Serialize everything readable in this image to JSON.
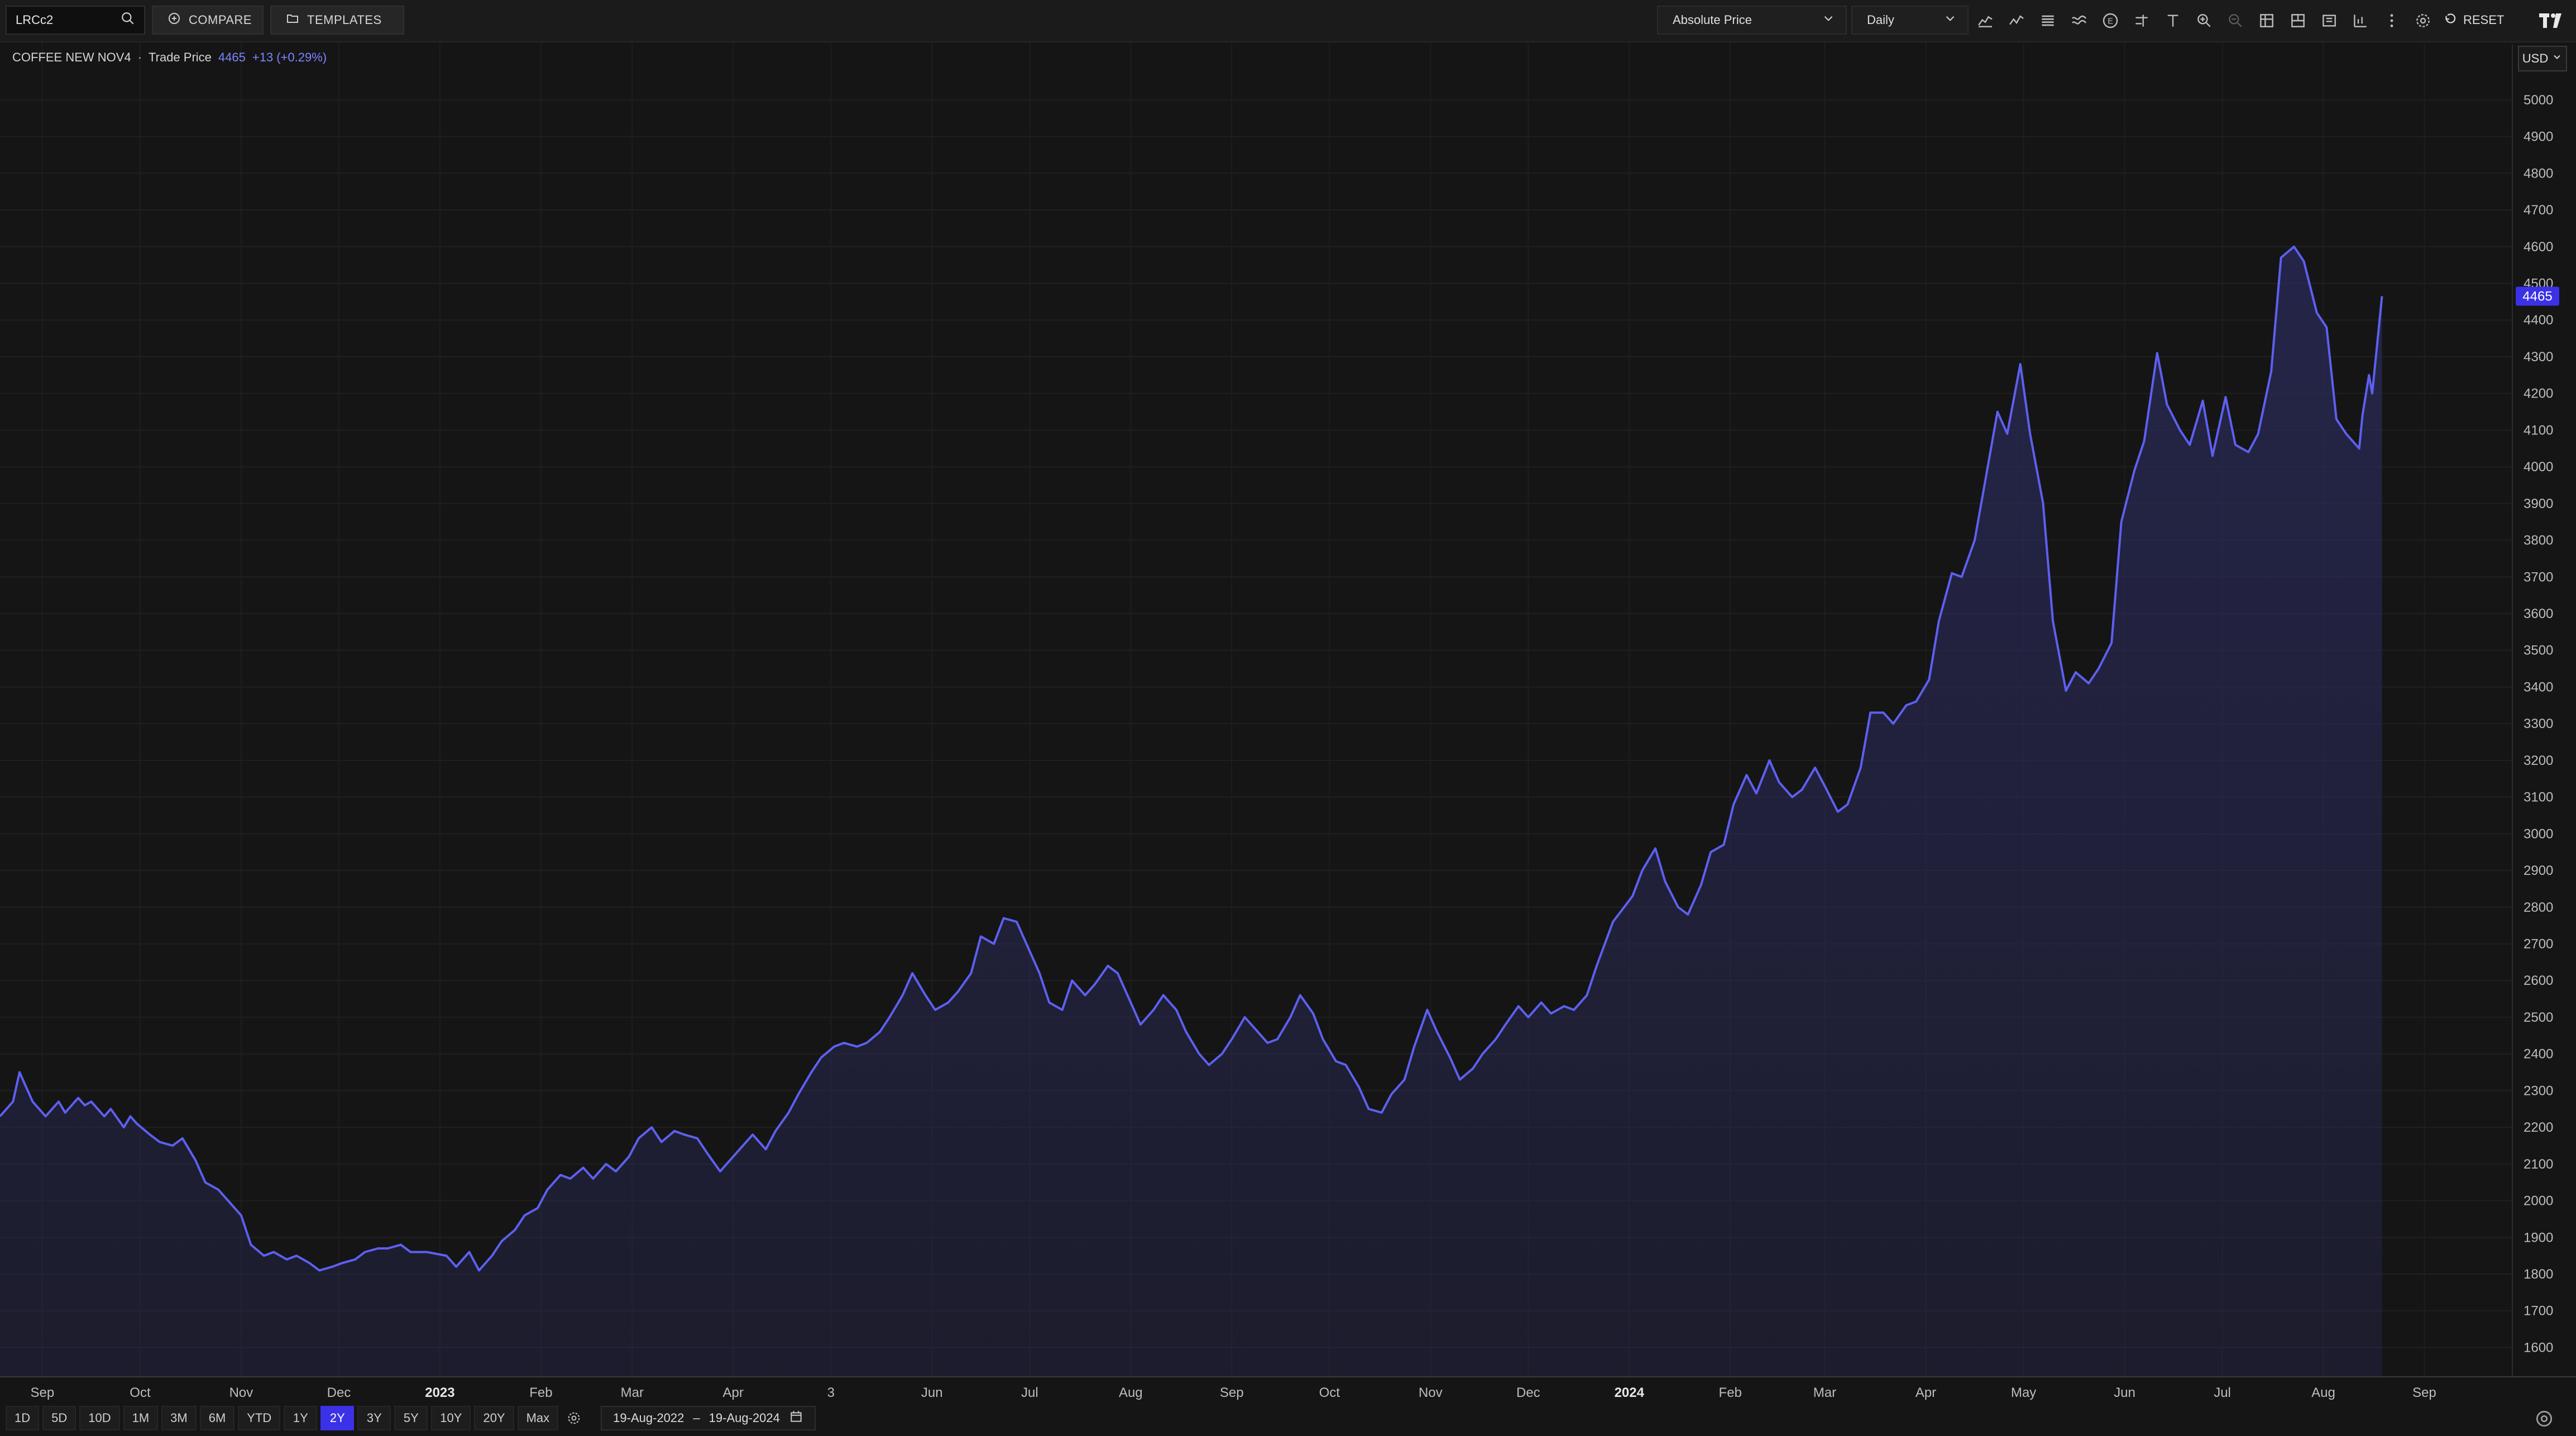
{
  "toolbar": {
    "ric": "LRCc2",
    "compare_label": "COMPARE",
    "templates_label": "TEMPLATES",
    "price_type": "Absolute Price",
    "interval": "Daily",
    "reset_label": "RESET",
    "icons": [
      "mountain-chart-icon",
      "line-chart-icon",
      "bar-chart-icon",
      "studies-icon",
      "events-icon",
      "trendline-icon",
      "text-tool-icon",
      "zoom-in-icon",
      "zoom-out-icon",
      "layout-icon",
      "panes-icon",
      "template-icon",
      "indicator-icon",
      "more-icon",
      "settings-icon"
    ]
  },
  "instrument": {
    "name": "COFFEE NEW NOV4",
    "separator": "·",
    "field": "Trade Price",
    "last": "4465",
    "change": "+13 (+0.29%)"
  },
  "currency": "USD",
  "range_buttons": [
    "1D",
    "5D",
    "10D",
    "1M",
    "3M",
    "6M",
    "YTD",
    "1Y",
    "2Y",
    "3Y",
    "5Y",
    "10Y",
    "20Y",
    "Max"
  ],
  "active_range": "2Y",
  "date_range": {
    "start": "19-Aug-2022",
    "separator": "–",
    "end": "19-Aug-2024"
  },
  "colors": {
    "line": "#5d60f0",
    "fill": "#2a2a5a",
    "accent": "#3b31e6",
    "background": "#151515"
  },
  "chart_data": {
    "type": "area",
    "title": "",
    "xlabel": "",
    "ylabel": "",
    "grid": true,
    "x_domain": [
      "2022-08-19",
      "2024-09-28"
    ],
    "ylim": [
      1520,
      5120
    ],
    "y_ticks": [
      1600,
      1700,
      1800,
      1900,
      2000,
      2100,
      2200,
      2300,
      2400,
      2500,
      2600,
      2700,
      2800,
      2900,
      3000,
      3100,
      3200,
      3300,
      3400,
      3500,
      3600,
      3700,
      3800,
      3900,
      4000,
      4100,
      4200,
      4300,
      4400,
      4500,
      4600,
      4700,
      4800,
      4900,
      5000
    ],
    "x_ticks": [
      {
        "label": "Sep",
        "date": "2022-09-01",
        "bold": false
      },
      {
        "label": "Oct",
        "date": "2022-10-01",
        "bold": false
      },
      {
        "label": "Nov",
        "date": "2022-11-01",
        "bold": false
      },
      {
        "label": "Dec",
        "date": "2022-12-01",
        "bold": false
      },
      {
        "label": "2023",
        "date": "2023-01-01",
        "bold": true
      },
      {
        "label": "Feb",
        "date": "2023-02-01",
        "bold": false
      },
      {
        "label": "Mar",
        "date": "2023-03-01",
        "bold": false
      },
      {
        "label": "Apr",
        "date": "2023-04-01",
        "bold": false
      },
      {
        "label": "3",
        "date": "2023-05-01",
        "bold": false
      },
      {
        "label": "Jun",
        "date": "2023-06-01",
        "bold": false
      },
      {
        "label": "Jul",
        "date": "2023-07-01",
        "bold": false
      },
      {
        "label": "Aug",
        "date": "2023-08-01",
        "bold": false
      },
      {
        "label": "Sep",
        "date": "2023-09-01",
        "bold": false
      },
      {
        "label": "Oct",
        "date": "2023-10-01",
        "bold": false
      },
      {
        "label": "Nov",
        "date": "2023-11-01",
        "bold": false
      },
      {
        "label": "Dec",
        "date": "2023-12-01",
        "bold": false
      },
      {
        "label": "2024",
        "date": "2024-01-01",
        "bold": true
      },
      {
        "label": "Feb",
        "date": "2024-02-01",
        "bold": false
      },
      {
        "label": "Mar",
        "date": "2024-03-01",
        "bold": false
      },
      {
        "label": "Apr",
        "date": "2024-04-01",
        "bold": false
      },
      {
        "label": "May",
        "date": "2024-05-01",
        "bold": false
      },
      {
        "label": "Jun",
        "date": "2024-06-01",
        "bold": false
      },
      {
        "label": "Jul",
        "date": "2024-07-01",
        "bold": false
      },
      {
        "label": "Aug",
        "date": "2024-08-01",
        "bold": false
      },
      {
        "label": "Sep",
        "date": "2024-09-01",
        "bold": false
      }
    ],
    "last_value_label": "4465",
    "series": [
      {
        "points": [
          [
            "2022-08-19",
            2230
          ],
          [
            "2022-08-23",
            2270
          ],
          [
            "2022-08-25",
            2350
          ],
          [
            "2022-08-29",
            2270
          ],
          [
            "2022-08-31",
            2250
          ],
          [
            "2022-09-02",
            2230
          ],
          [
            "2022-09-06",
            2270
          ],
          [
            "2022-09-08",
            2240
          ],
          [
            "2022-09-12",
            2280
          ],
          [
            "2022-09-14",
            2260
          ],
          [
            "2022-09-16",
            2270
          ],
          [
            "2022-09-20",
            2230
          ],
          [
            "2022-09-22",
            2250
          ],
          [
            "2022-09-26",
            2200
          ],
          [
            "2022-09-28",
            2230
          ],
          [
            "2022-09-30",
            2210
          ],
          [
            "2022-10-04",
            2180
          ],
          [
            "2022-10-07",
            2160
          ],
          [
            "2022-10-11",
            2150
          ],
          [
            "2022-10-14",
            2170
          ],
          [
            "2022-10-18",
            2110
          ],
          [
            "2022-10-21",
            2050
          ],
          [
            "2022-10-25",
            2030
          ],
          [
            "2022-10-28",
            2000
          ],
          [
            "2022-11-01",
            1960
          ],
          [
            "2022-11-04",
            1880
          ],
          [
            "2022-11-08",
            1850
          ],
          [
            "2022-11-11",
            1860
          ],
          [
            "2022-11-15",
            1840
          ],
          [
            "2022-11-18",
            1850
          ],
          [
            "2022-11-22",
            1830
          ],
          [
            "2022-11-25",
            1810
          ],
          [
            "2022-11-29",
            1820
          ],
          [
            "2022-12-02",
            1830
          ],
          [
            "2022-12-06",
            1840
          ],
          [
            "2022-12-09",
            1860
          ],
          [
            "2022-12-13",
            1870
          ],
          [
            "2022-12-16",
            1870
          ],
          [
            "2022-12-20",
            1880
          ],
          [
            "2022-12-23",
            1860
          ],
          [
            "2022-12-28",
            1860
          ],
          [
            "2023-01-03",
            1850
          ],
          [
            "2023-01-06",
            1820
          ],
          [
            "2023-01-10",
            1860
          ],
          [
            "2023-01-13",
            1810
          ],
          [
            "2023-01-17",
            1850
          ],
          [
            "2023-01-20",
            1890
          ],
          [
            "2023-01-24",
            1920
          ],
          [
            "2023-01-27",
            1960
          ],
          [
            "2023-01-31",
            1980
          ],
          [
            "2023-02-03",
            2030
          ],
          [
            "2023-02-07",
            2070
          ],
          [
            "2023-02-10",
            2060
          ],
          [
            "2023-02-14",
            2090
          ],
          [
            "2023-02-17",
            2060
          ],
          [
            "2023-02-21",
            2100
          ],
          [
            "2023-02-24",
            2080
          ],
          [
            "2023-02-28",
            2120
          ],
          [
            "2023-03-03",
            2170
          ],
          [
            "2023-03-07",
            2200
          ],
          [
            "2023-03-10",
            2160
          ],
          [
            "2023-03-14",
            2190
          ],
          [
            "2023-03-17",
            2180
          ],
          [
            "2023-03-21",
            2170
          ],
          [
            "2023-03-24",
            2130
          ],
          [
            "2023-03-28",
            2080
          ],
          [
            "2023-03-31",
            2110
          ],
          [
            "2023-04-04",
            2150
          ],
          [
            "2023-04-07",
            2180
          ],
          [
            "2023-04-11",
            2140
          ],
          [
            "2023-04-14",
            2190
          ],
          [
            "2023-04-18",
            2240
          ],
          [
            "2023-04-21",
            2290
          ],
          [
            "2023-04-25",
            2350
          ],
          [
            "2023-04-28",
            2390
          ],
          [
            "2023-05-02",
            2420
          ],
          [
            "2023-05-05",
            2430
          ],
          [
            "2023-05-09",
            2420
          ],
          [
            "2023-05-12",
            2430
          ],
          [
            "2023-05-16",
            2460
          ],
          [
            "2023-05-19",
            2500
          ],
          [
            "2023-05-23",
            2560
          ],
          [
            "2023-05-26",
            2620
          ],
          [
            "2023-05-30",
            2560
          ],
          [
            "2023-06-02",
            2520
          ],
          [
            "2023-06-06",
            2540
          ],
          [
            "2023-06-09",
            2570
          ],
          [
            "2023-06-13",
            2620
          ],
          [
            "2023-06-16",
            2720
          ],
          [
            "2023-06-20",
            2700
          ],
          [
            "2023-06-23",
            2770
          ],
          [
            "2023-06-27",
            2760
          ],
          [
            "2023-06-30",
            2700
          ],
          [
            "2023-07-04",
            2620
          ],
          [
            "2023-07-07",
            2540
          ],
          [
            "2023-07-11",
            2520
          ],
          [
            "2023-07-14",
            2600
          ],
          [
            "2023-07-18",
            2560
          ],
          [
            "2023-07-21",
            2590
          ],
          [
            "2023-07-25",
            2640
          ],
          [
            "2023-07-28",
            2620
          ],
          [
            "2023-08-01",
            2540
          ],
          [
            "2023-08-04",
            2480
          ],
          [
            "2023-08-08",
            2520
          ],
          [
            "2023-08-11",
            2560
          ],
          [
            "2023-08-15",
            2520
          ],
          [
            "2023-08-18",
            2460
          ],
          [
            "2023-08-22",
            2400
          ],
          [
            "2023-08-25",
            2370
          ],
          [
            "2023-08-29",
            2400
          ],
          [
            "2023-09-01",
            2440
          ],
          [
            "2023-09-05",
            2500
          ],
          [
            "2023-09-08",
            2470
          ],
          [
            "2023-09-12",
            2430
          ],
          [
            "2023-09-15",
            2440
          ],
          [
            "2023-09-19",
            2500
          ],
          [
            "2023-09-22",
            2560
          ],
          [
            "2023-09-26",
            2510
          ],
          [
            "2023-09-29",
            2440
          ],
          [
            "2023-10-03",
            2380
          ],
          [
            "2023-10-06",
            2370
          ],
          [
            "2023-10-10",
            2310
          ],
          [
            "2023-10-13",
            2250
          ],
          [
            "2023-10-17",
            2240
          ],
          [
            "2023-10-20",
            2290
          ],
          [
            "2023-10-24",
            2330
          ],
          [
            "2023-10-27",
            2420
          ],
          [
            "2023-10-31",
            2520
          ],
          [
            "2023-11-03",
            2460
          ],
          [
            "2023-11-07",
            2390
          ],
          [
            "2023-11-10",
            2330
          ],
          [
            "2023-11-14",
            2360
          ],
          [
            "2023-11-17",
            2400
          ],
          [
            "2023-11-21",
            2440
          ],
          [
            "2023-11-24",
            2480
          ],
          [
            "2023-11-28",
            2530
          ],
          [
            "2023-12-01",
            2500
          ],
          [
            "2023-12-05",
            2540
          ],
          [
            "2023-12-08",
            2510
          ],
          [
            "2023-12-12",
            2530
          ],
          [
            "2023-12-15",
            2520
          ],
          [
            "2023-12-19",
            2560
          ],
          [
            "2023-12-22",
            2640
          ],
          [
            "2023-12-27",
            2760
          ],
          [
            "2024-01-02",
            2830
          ],
          [
            "2024-01-05",
            2900
          ],
          [
            "2024-01-09",
            2960
          ],
          [
            "2024-01-12",
            2870
          ],
          [
            "2024-01-16",
            2800
          ],
          [
            "2024-01-19",
            2780
          ],
          [
            "2024-01-23",
            2860
          ],
          [
            "2024-01-26",
            2950
          ],
          [
            "2024-01-30",
            2970
          ],
          [
            "2024-02-02",
            3080
          ],
          [
            "2024-02-06",
            3160
          ],
          [
            "2024-02-09",
            3110
          ],
          [
            "2024-02-13",
            3200
          ],
          [
            "2024-02-16",
            3140
          ],
          [
            "2024-02-20",
            3100
          ],
          [
            "2024-02-23",
            3120
          ],
          [
            "2024-02-27",
            3180
          ],
          [
            "2024-03-01",
            3130
          ],
          [
            "2024-03-05",
            3060
          ],
          [
            "2024-03-08",
            3080
          ],
          [
            "2024-03-12",
            3180
          ],
          [
            "2024-03-15",
            3330
          ],
          [
            "2024-03-19",
            3330
          ],
          [
            "2024-03-22",
            3300
          ],
          [
            "2024-03-26",
            3350
          ],
          [
            "2024-03-29",
            3360
          ],
          [
            "2024-04-02",
            3420
          ],
          [
            "2024-04-05",
            3580
          ],
          [
            "2024-04-09",
            3710
          ],
          [
            "2024-04-12",
            3700
          ],
          [
            "2024-04-16",
            3800
          ],
          [
            "2024-04-19",
            3950
          ],
          [
            "2024-04-23",
            4150
          ],
          [
            "2024-04-26",
            4090
          ],
          [
            "2024-04-30",
            4280
          ],
          [
            "2024-05-03",
            4090
          ],
          [
            "2024-05-07",
            3900
          ],
          [
            "2024-05-10",
            3580
          ],
          [
            "2024-05-14",
            3390
          ],
          [
            "2024-05-17",
            3440
          ],
          [
            "2024-05-21",
            3410
          ],
          [
            "2024-05-24",
            3450
          ],
          [
            "2024-05-28",
            3520
          ],
          [
            "2024-05-31",
            3850
          ],
          [
            "2024-06-04",
            3990
          ],
          [
            "2024-06-07",
            4070
          ],
          [
            "2024-06-11",
            4310
          ],
          [
            "2024-06-14",
            4170
          ],
          [
            "2024-06-18",
            4100
          ],
          [
            "2024-06-21",
            4060
          ],
          [
            "2024-06-25",
            4180
          ],
          [
            "2024-06-28",
            4030
          ],
          [
            "2024-07-02",
            4190
          ],
          [
            "2024-07-05",
            4060
          ],
          [
            "2024-07-09",
            4040
          ],
          [
            "2024-07-12",
            4090
          ],
          [
            "2024-07-16",
            4260
          ],
          [
            "2024-07-19",
            4570
          ],
          [
            "2024-07-23",
            4600
          ],
          [
            "2024-07-26",
            4560
          ],
          [
            "2024-07-30",
            4420
          ],
          [
            "2024-08-02",
            4380
          ],
          [
            "2024-08-05",
            4130
          ],
          [
            "2024-08-08",
            4090
          ],
          [
            "2024-08-12",
            4050
          ],
          [
            "2024-08-13",
            4140
          ],
          [
            "2024-08-15",
            4250
          ],
          [
            "2024-08-16",
            4200
          ],
          [
            "2024-08-19",
            4465
          ]
        ]
      }
    ]
  }
}
